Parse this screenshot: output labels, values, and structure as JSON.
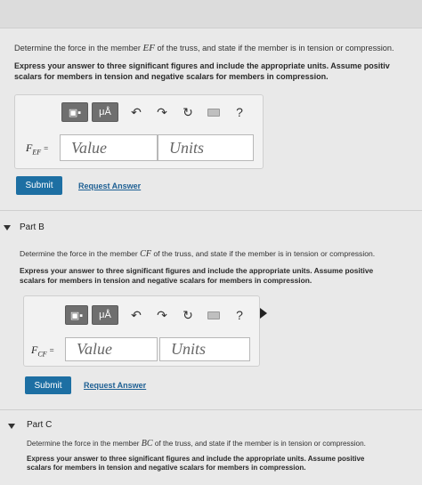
{
  "partA": {
    "question_prefix": "Determine the force in the member ",
    "member": "EF",
    "question_suffix": " of the truss, and state if the member is in tension or compression.",
    "instructions_line1": "Express your answer to three significant figures and include the appropriate units. Assume positiv",
    "instructions_line2": "scalars for members in tension and negative scalars for members in compression.",
    "label_main": "F",
    "label_sub": "EF",
    "equals": "=",
    "value_placeholder": "Value",
    "units_placeholder": "Units",
    "submit": "Submit",
    "request_answer": "Request Answer"
  },
  "partB": {
    "title": "Part B",
    "question_prefix": "Determine the force in the member ",
    "member": "CF",
    "question_suffix": " of the truss, and state if the member is in tension or compression.",
    "instructions_line1": "Express your answer to three significant figures and include the appropriate units. Assume positive",
    "instructions_line2": "scalars for members in tension and negative scalars for members in compression.",
    "label_main": "F",
    "label_sub": "CF",
    "equals": "=",
    "value_placeholder": "Value",
    "units_placeholder": "Units",
    "submit": "Submit",
    "request_answer": "Request Answer"
  },
  "partC": {
    "title": "Part C",
    "question_prefix": "Determine the force in the member ",
    "member": "BC",
    "question_suffix": " of the truss, and state if the member is in tension or compression.",
    "instructions_line1": "Express your answer to three significant figures and include the appropriate units. Assume positive",
    "instructions_line2": "scalars for members in tension and negative scalars for members in compression."
  },
  "toolbar": {
    "units_symbol": "μÅ",
    "help": "?",
    "icons": [
      "templates-icon",
      "units-icon",
      "undo-icon",
      "redo-icon",
      "reset-icon",
      "keyboard-icon",
      "help-icon"
    ]
  },
  "colors": {
    "submit_bg": "#1d6fa3",
    "link": "#1d5f93",
    "toolbar_btn": "#6f6f6f"
  }
}
